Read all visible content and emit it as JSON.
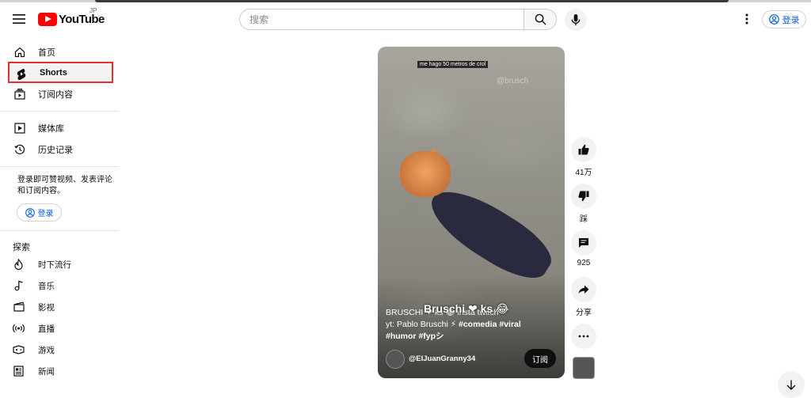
{
  "header": {
    "logo_text": "YouTube",
    "region": "JP",
    "search_placeholder": "搜索",
    "signin_label": "登录"
  },
  "sidebar": {
    "items": [
      {
        "label": "首页",
        "icon": "home-icon"
      },
      {
        "label": "Shorts",
        "icon": "shorts-icon",
        "active": true
      },
      {
        "label": "订阅内容",
        "icon": "subscriptions-icon"
      },
      {
        "label": "媒体库",
        "icon": "library-icon"
      },
      {
        "label": "历史记录",
        "icon": "history-icon"
      }
    ],
    "signin_message": "登录即可赞视频、发表评论和订阅内容。",
    "signin_label": "登录",
    "explore_title": "探索",
    "explore_items": [
      {
        "label": "时下流行",
        "icon": "trending-icon"
      },
      {
        "label": "音乐",
        "icon": "music-icon"
      },
      {
        "label": "影视",
        "icon": "movies-icon"
      },
      {
        "label": "直播",
        "icon": "live-icon"
      },
      {
        "label": "游戏",
        "icon": "gaming-icon"
      },
      {
        "label": "新闻",
        "icon": "news-icon"
      }
    ]
  },
  "video": {
    "caption": "me hago 50 metros de crol",
    "watermark": "@brusch",
    "overlay_name": "Bruschi ❤ ks 😂",
    "description_line1": "BRUSCHI ❤ ks 😂 insta twitch",
    "description_line2_prefix": "yt: Pablo Bruschi ⚡ ",
    "hashtag_comedia": "#comedia",
    "hashtag_viral": "#viral",
    "hashtag_humor": "#humor",
    "hashtag_fyp": "#fypシ",
    "channel": "@ElJuanGranny34",
    "subscribe_label": "订阅"
  },
  "actions": {
    "like_count": "41万",
    "dislike_label": "踩",
    "comment_count": "925",
    "share_label": "分享"
  },
  "colors": {
    "brand_red": "#ff0000",
    "link_blue": "#065fd4",
    "highlight_border": "#e03030"
  }
}
